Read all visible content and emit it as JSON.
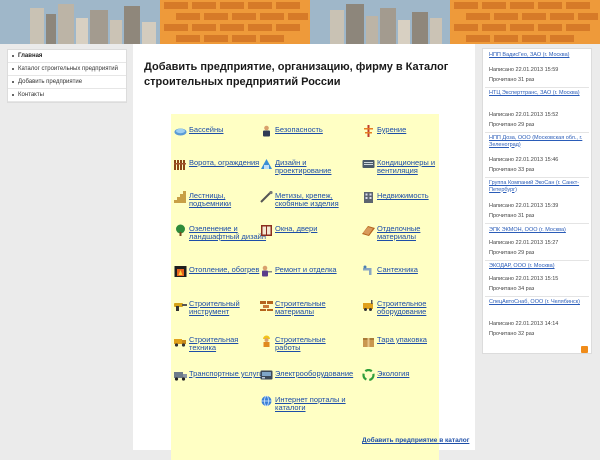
{
  "menu": {
    "items": [
      {
        "label": "Главная",
        "active": true
      },
      {
        "label": "Каталог строительных предприятий",
        "active": false
      },
      {
        "label": "Добавить предприятие",
        "active": false
      },
      {
        "label": "Контакты",
        "active": false
      }
    ]
  },
  "main": {
    "title": "Добавить предприятие, организацию, фирму в Каталог строительных предприятий России",
    "add_link": "Добавить предприятие в каталог"
  },
  "categories": [
    {
      "label": "Бассейны",
      "icon": "pool-icon"
    },
    {
      "label": "Безопасность",
      "icon": "guard-icon"
    },
    {
      "label": "Бурение",
      "icon": "drilling-icon"
    },
    {
      "label": "Ворота, ограждения",
      "icon": "gate-icon"
    },
    {
      "label": "Дизайн и проектирование",
      "icon": "design-icon"
    },
    {
      "label": "Кондиционеры и вентиляция",
      "icon": "air-conditioner-icon"
    },
    {
      "label": "Лестницы, подъемники",
      "icon": "stairs-icon"
    },
    {
      "label": "Метизы, крепеж, скобяные изделия",
      "icon": "tools-icon"
    },
    {
      "label": "Недвижимость",
      "icon": "building-icon"
    },
    {
      "label": "Озеленение и ландшафтный дизайн",
      "icon": "tree-icon"
    },
    {
      "label": "Окна, двери",
      "icon": "window-icon"
    },
    {
      "label": "Отделочные материалы",
      "icon": "finishing-icon"
    },
    {
      "label": "Отопление, обогрев",
      "icon": "fireplace-icon"
    },
    {
      "label": "Ремонт и отделка",
      "icon": "repair-icon"
    },
    {
      "label": "Сантехника",
      "icon": "plumbing-icon"
    },
    {
      "label": "Строительный инструмент",
      "icon": "construction-tool-icon"
    },
    {
      "label": "Строительные материалы",
      "icon": "bricks-icon"
    },
    {
      "label": "Строительное оборудование",
      "icon": "equipment-icon"
    },
    {
      "label": "Строительная техника",
      "icon": "truck-icon"
    },
    {
      "label": "Строительные работы",
      "icon": "worker-icon"
    },
    {
      "label": "Тара упаковка",
      "icon": "box-icon"
    },
    {
      "label": "Транспортные услуги",
      "icon": "transport-icon"
    },
    {
      "label": "Электрооборудование",
      "icon": "electric-icon"
    },
    {
      "label": "Экология",
      "icon": "recycle-icon"
    },
    {
      "label": "Интернет порталы и каталоги",
      "icon": "globe-icon"
    }
  ],
  "companies": [
    {
      "name": "НПП ВадисГео, ЗАО (г. Москва)",
      "posted": "Написано 22.01.2013 15:59",
      "views": "Прочитано 31 раз"
    },
    {
      "name": "НТЦ Эксперттранс, ЗАО (г. Москва)",
      "posted": "Написано 22.01.2013 15:52",
      "views": "Прочитано 29 раз"
    },
    {
      "name": "НПП Доза, ООО (Московская обл., г. Зеленоград)",
      "posted": "Написано 22.01.2013 15:46",
      "views": "Прочитано 33 раз"
    },
    {
      "name": "Группа Компаний ЭкоСан (г. Санкт-Петербург)",
      "posted": "Написано 22.01.2013 15:39",
      "views": "Прочитано 31 раз"
    },
    {
      "name": "ЭПК ЭКМОН, ООО (г. Москва)",
      "posted": "Написано 22.01.2013 15:27",
      "views": "Прочитано 29 раз"
    },
    {
      "name": "ЭКОДАР, ООО (г. Москва)",
      "posted": "Написано 22.01.2013 15:15",
      "views": "Прочитано 34 раз"
    },
    {
      "name": "СпецАвтоСнаб, ООО (г. Челябинск)",
      "posted": "Написано 22.01.2013 14:14",
      "views": "Прочитано 32 раз"
    }
  ],
  "colors": {
    "banner": "#f3a53e",
    "category_panel": "#ffffc4",
    "link": "#1d4ea8",
    "rss": "#f08c1a"
  }
}
